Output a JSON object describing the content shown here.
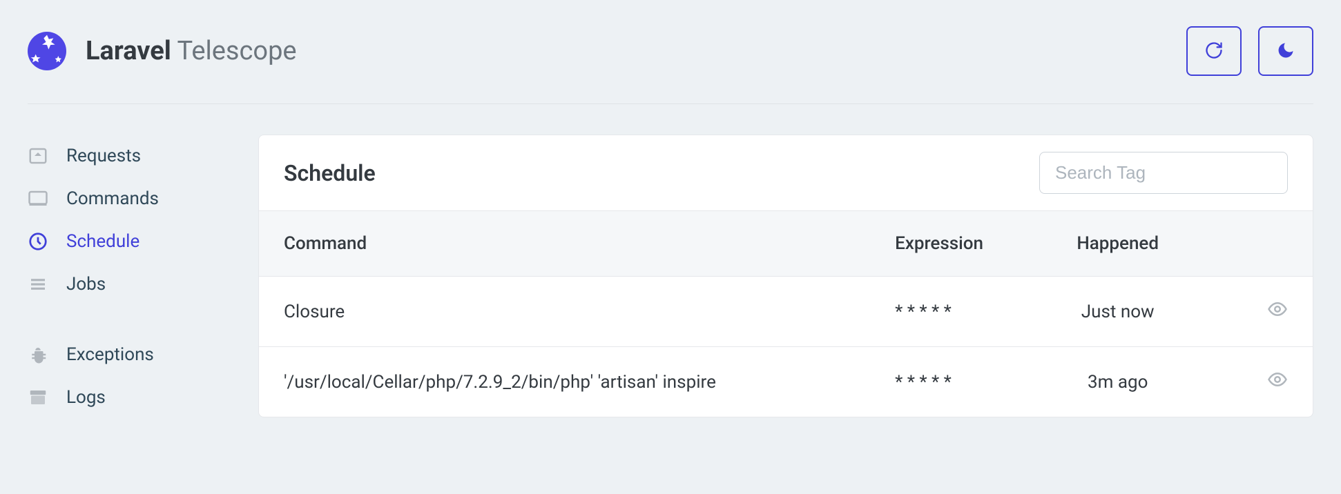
{
  "brand": {
    "bold": "Laravel",
    "light": "Telescope"
  },
  "sidebar": {
    "group1": [
      {
        "label": "Requests",
        "icon": "request"
      },
      {
        "label": "Commands",
        "icon": "terminal"
      },
      {
        "label": "Schedule",
        "icon": "clock",
        "active": true
      },
      {
        "label": "Jobs",
        "icon": "list"
      }
    ],
    "group2": [
      {
        "label": "Exceptions",
        "icon": "bug"
      },
      {
        "label": "Logs",
        "icon": "archive"
      }
    ]
  },
  "page": {
    "title": "Schedule",
    "search_placeholder": "Search Tag",
    "columns": {
      "command": "Command",
      "expression": "Expression",
      "happened": "Happened"
    },
    "rows": [
      {
        "command": "Closure",
        "expression": "* * * * *",
        "happened": "Just now"
      },
      {
        "command": "'/usr/local/Cellar/php/7.2.9_2/bin/php' 'artisan' inspire",
        "expression": "* * * * *",
        "happened": "3m ago"
      }
    ]
  }
}
